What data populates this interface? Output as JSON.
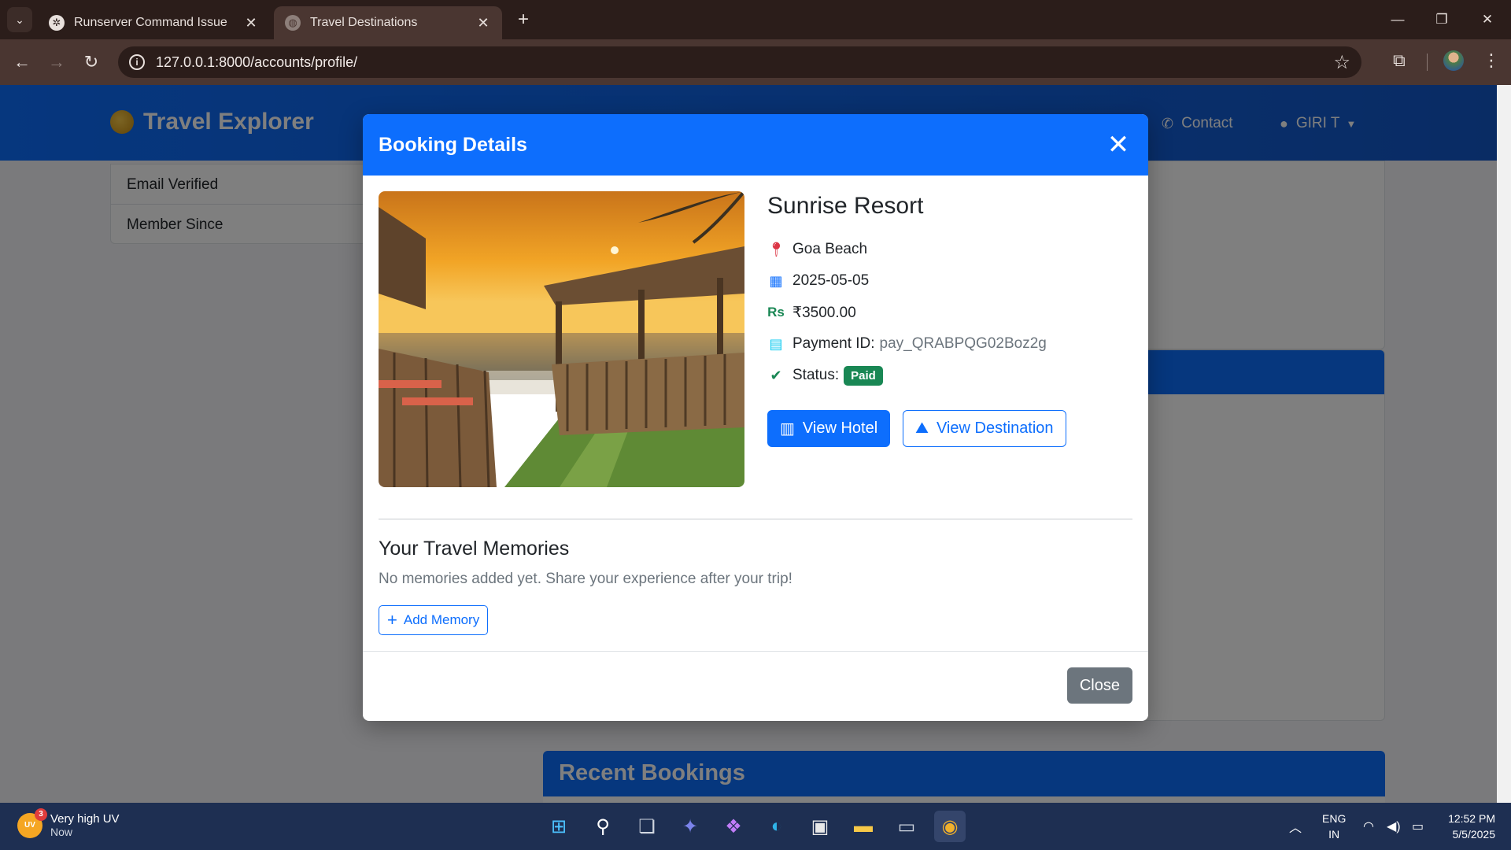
{
  "browser": {
    "tabs": [
      {
        "title": "Runserver Command Issue",
        "favicon": "chatgpt-icon",
        "active": false
      },
      {
        "title": "Travel Destinations",
        "favicon": "globe-icon",
        "active": true
      }
    ],
    "url": "127.0.0.1:8000/accounts/profile/"
  },
  "site": {
    "brand": "Travel Explorer",
    "nav_contact": "Contact",
    "nav_user": "GIRI T"
  },
  "profile": {
    "rows": [
      "Email Verified",
      "Member Since"
    ],
    "recent_bookings_title": "Recent Bookings"
  },
  "modal": {
    "title": "Booking Details",
    "hotel_name": "Sunrise Resort",
    "location": "Goa Beach",
    "date": "2025-05-05",
    "currency_symbol": "Rs",
    "price": "₹3500.00",
    "payment_label": "Payment ID:",
    "payment_id": "pay_QRABPQG02Boz2g",
    "status_label": "Status:",
    "status_badge": "Paid",
    "view_hotel": "View Hotel",
    "view_destination": "View Destination",
    "memories_title": "Your Travel Memories",
    "memories_empty": "No memories added yet. Share your experience after your trip!",
    "add_memory": "Add Memory",
    "close": "Close"
  },
  "taskbar": {
    "weather_badge": "UV",
    "weather_count": "3",
    "weather_title": "Very high UV",
    "weather_time": "Now",
    "lang_1": "ENG",
    "lang_2": "IN",
    "time": "12:52 PM",
    "date": "5/5/2025"
  },
  "colors": {
    "primary": "#0d6efd",
    "success": "#198754",
    "secondary": "#6c757d",
    "taskbar": "#1e2f52",
    "chrome": "#4a3631"
  }
}
